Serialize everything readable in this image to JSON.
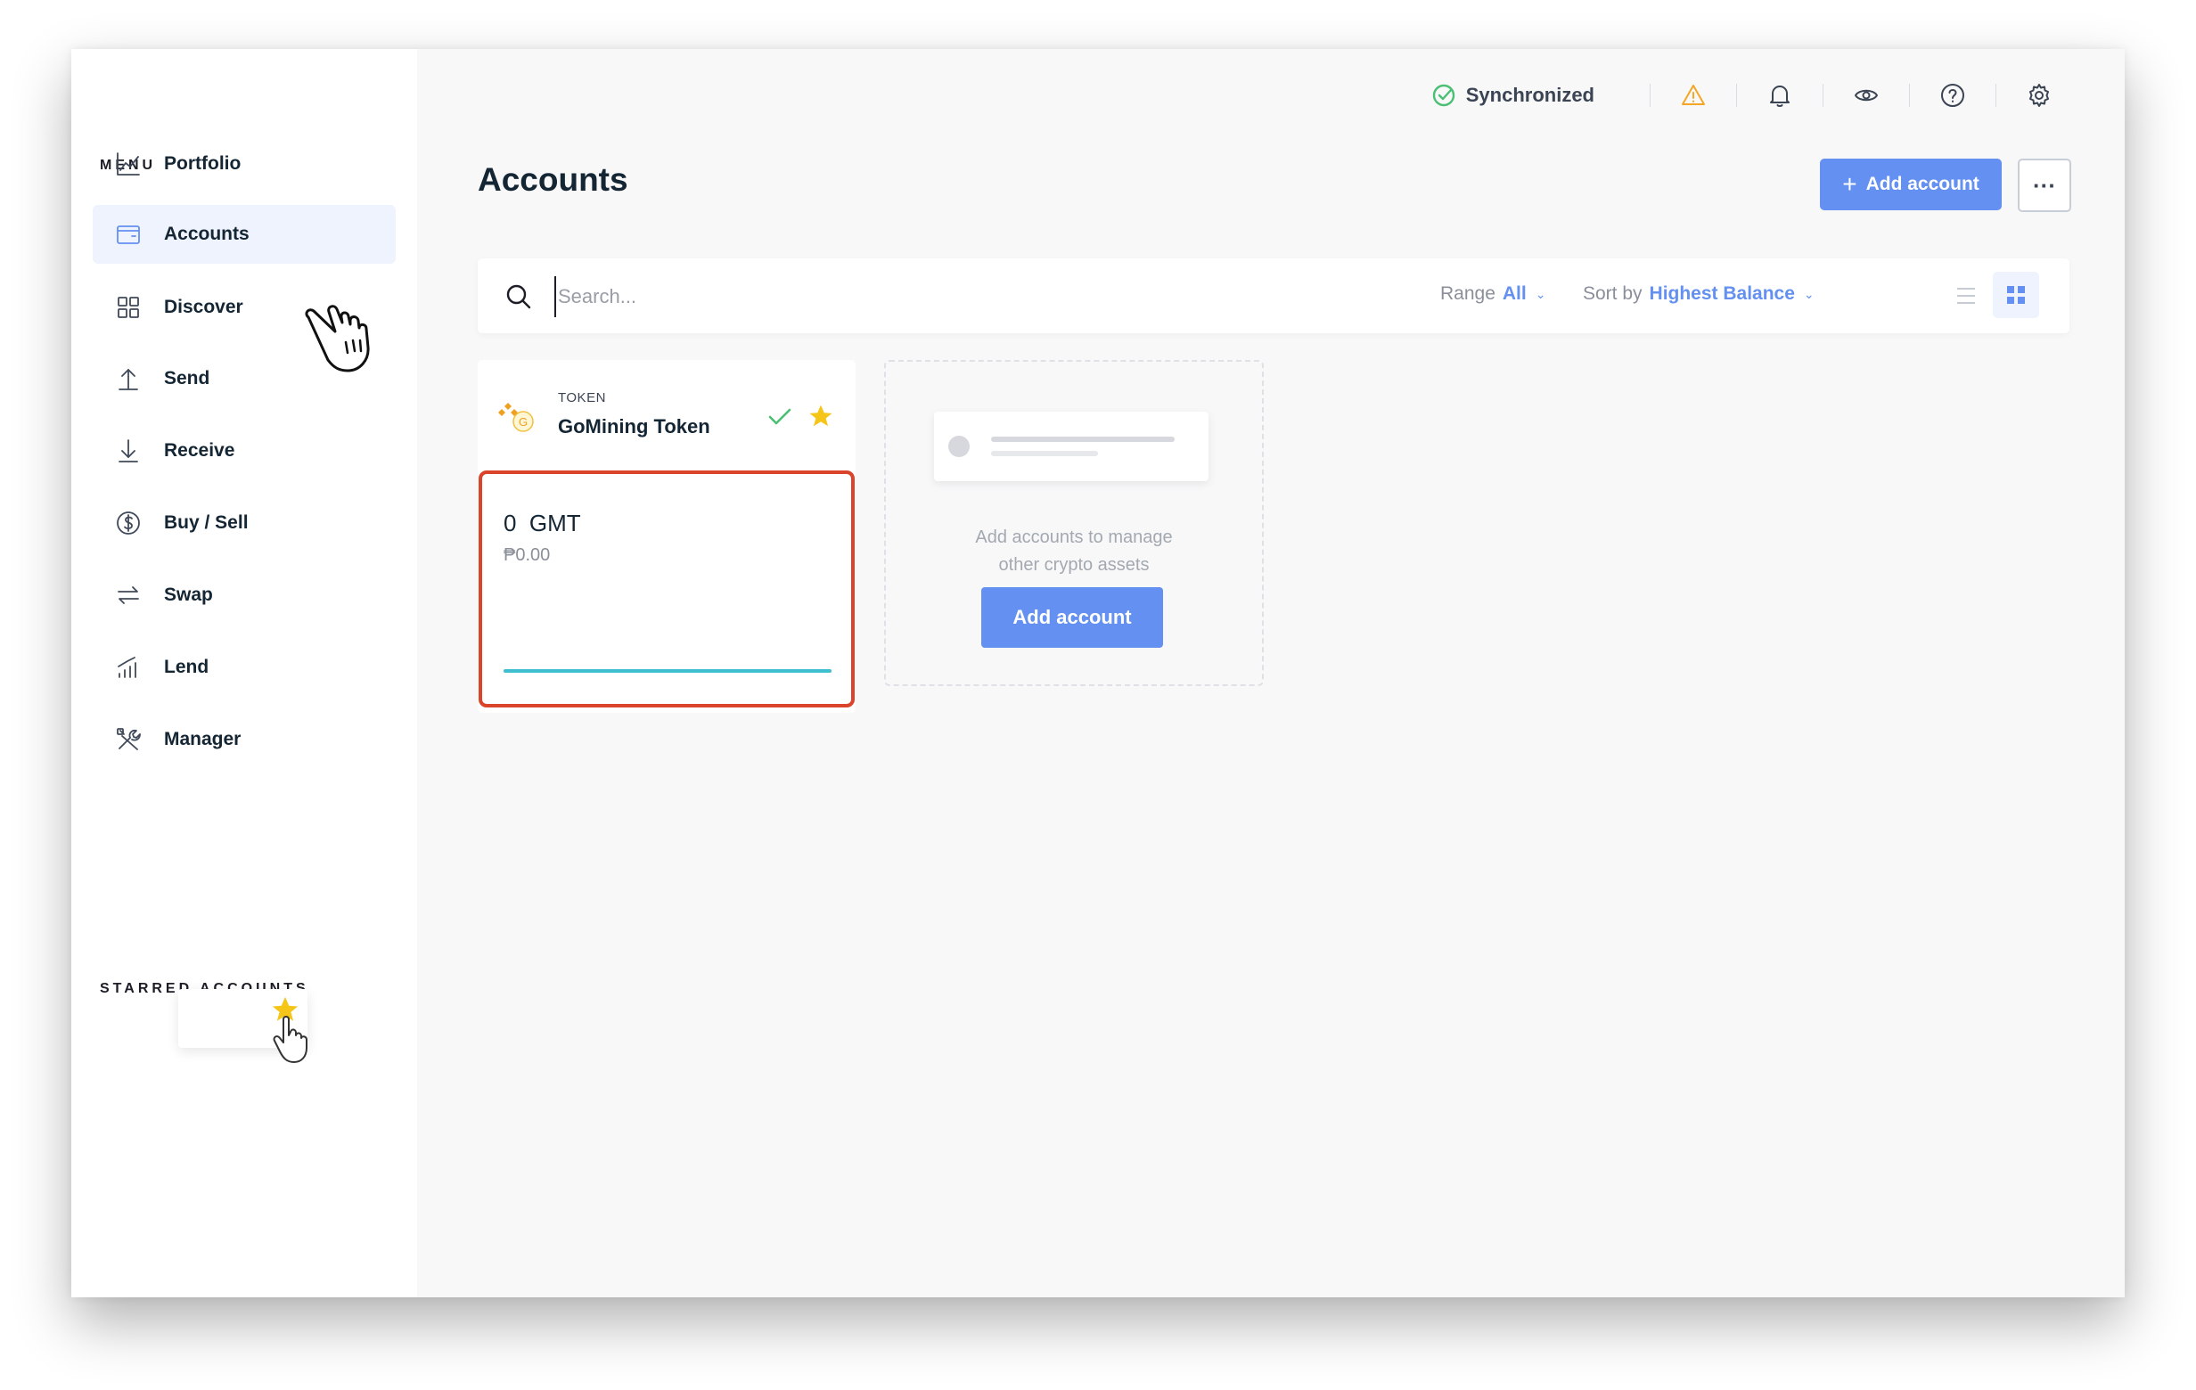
{
  "sidebar": {
    "menu_title": "MENU",
    "items": [
      {
        "label": "Portfolio",
        "icon": "chart-icon"
      },
      {
        "label": "Accounts",
        "icon": "wallet-icon",
        "active": true
      },
      {
        "label": "Discover",
        "icon": "grid-icon"
      },
      {
        "label": "Send",
        "icon": "send-arrow-icon"
      },
      {
        "label": "Receive",
        "icon": "receive-arrow-icon"
      },
      {
        "label": "Buy / Sell",
        "icon": "dollar-coin-icon"
      },
      {
        "label": "Swap",
        "icon": "swap-icon"
      },
      {
        "label": "Lend",
        "icon": "lend-bars-icon"
      },
      {
        "label": "Manager",
        "icon": "tools-icon"
      }
    ],
    "starred_title": "STARRED ACCOUNTS"
  },
  "topbar": {
    "sync_label": "Synchronized",
    "sync_color": "#4bbf73",
    "warning_color": "#f5a623"
  },
  "main": {
    "title": "Accounts",
    "add_account_label": "Add account",
    "more_label": "···",
    "search": {
      "placeholder": "Search...",
      "value": ""
    },
    "range": {
      "label": "Range",
      "value": "All"
    },
    "sort": {
      "label": "Sort by",
      "value": "Highest Balance"
    },
    "accent_color": "#6490f1"
  },
  "account_card": {
    "type_label": "TOKEN",
    "name": "GoMining Token",
    "amount": "0",
    "ticker": "GMT",
    "fiat": "₱0.00",
    "highlight_color": "#d9442a",
    "sparkline_color": "#3fbecf"
  },
  "add_card": {
    "line1": "Add accounts to manage",
    "line2": "other crypto assets",
    "button_label": "Add account"
  }
}
